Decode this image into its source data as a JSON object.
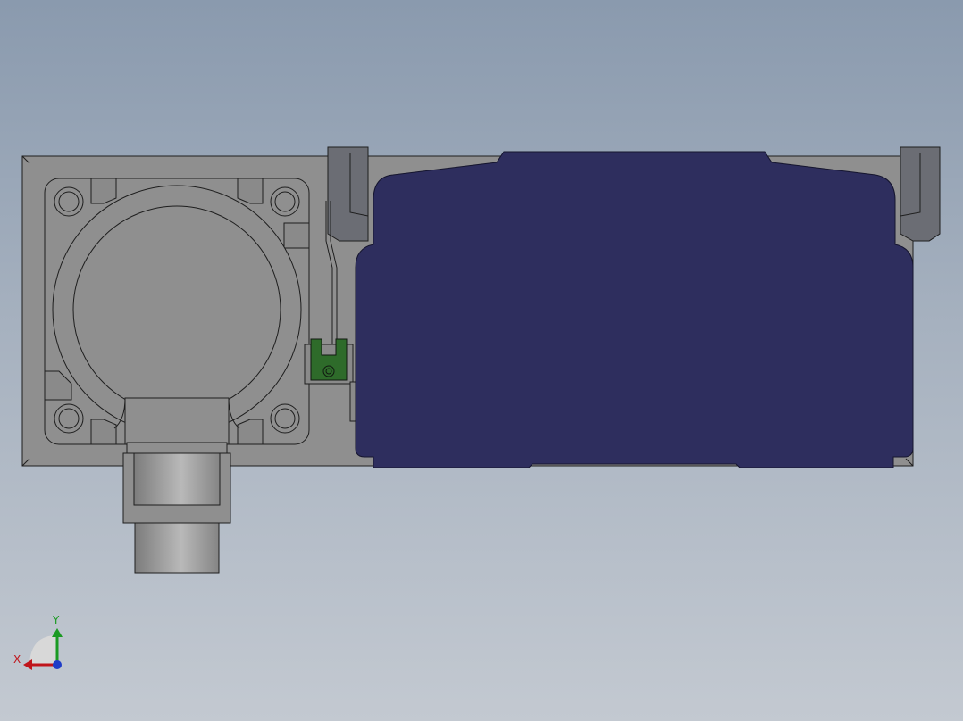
{
  "viewport": {
    "background_top": "#8a9aae",
    "background_bottom": "#c3c9d1"
  },
  "model": {
    "body_color": "#8f8f8f",
    "cover_color": "#2e2e5e",
    "clip_color": "#2e6b2a",
    "edge_color": "#1e1e1e"
  },
  "triad": {
    "x_label": "X",
    "y_label": "Y",
    "x_color": "#c0151b",
    "y_color": "#1a9a22",
    "z_color": "#1e3cc8"
  }
}
